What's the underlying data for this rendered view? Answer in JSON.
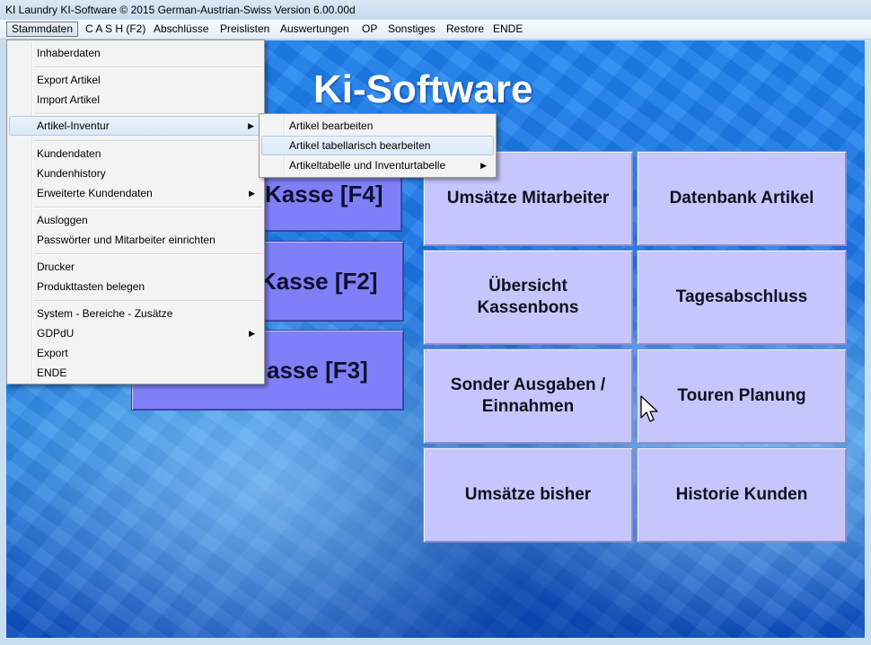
{
  "window": {
    "title": "KI Laundry KI-Software © 2015 German-Austrian-Swiss Version 6.00.00d"
  },
  "menubar": {
    "items": [
      "Stammdaten",
      "C A S H (F2)",
      "Abschlüsse",
      "Preislisten",
      "Auswertungen",
      "OP",
      "Sonstiges",
      "Restore",
      "ENDE"
    ],
    "active": "Stammdaten"
  },
  "app": {
    "heading": "Ki-Software"
  },
  "kasse_buttons": [
    "Kasse [F4]",
    "Kasse [F2]",
    "asse [F3]"
  ],
  "tiles": [
    [
      "Umsätze Mitarbeiter"
    ],
    [
      "Datenbank Artikel"
    ],
    [
      "Übersicht",
      "Kassenbons"
    ],
    [
      "Tagesabschluss"
    ],
    [
      "Sonder Ausgaben /",
      "Einnahmen"
    ],
    [
      "Touren Planung"
    ],
    [
      "Umsätze bisher"
    ],
    [
      "Historie Kunden"
    ]
  ],
  "stammdaten_menu": {
    "items": [
      "Inhaberdaten",
      "Export Artikel",
      "Import Artikel",
      "Artikel-Inventur",
      "Kundendaten",
      "Kundenhistory",
      "Erweiterte Kundendaten",
      "Ausloggen",
      "Passwörter und Mitarbeiter einrichten",
      "Drucker",
      "Produkttasten belegen",
      "System - Bereiche - Zusätze",
      "GDPdU",
      "Export",
      "ENDE"
    ],
    "highlighted": "Artikel-Inventur"
  },
  "inventur_submenu": {
    "items": [
      "Artikel bearbeiten",
      "Artikel tabellarisch bearbeiten",
      "Artikeltabelle und Inventurtabelle"
    ],
    "highlighted": "Artikel tabellarisch bearbeiten"
  },
  "icons": {
    "submenu_arrow": "triangle-right-icon",
    "pointer": "mouse-cursor-icon"
  },
  "colors": {
    "kasse_button": "#7f7ff8",
    "tile": "#c6c6fc",
    "background": "#1e7ae8"
  }
}
